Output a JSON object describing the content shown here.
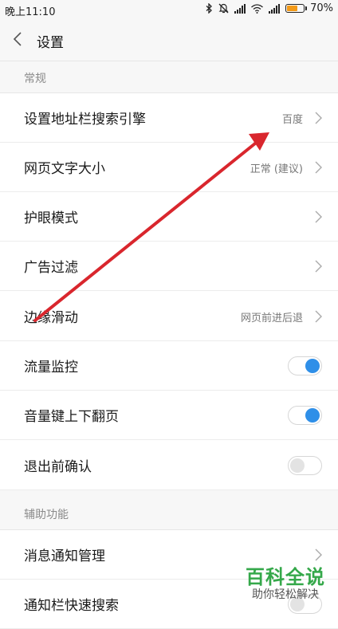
{
  "status_bar": {
    "time": "晚上11:10",
    "battery": "70%",
    "battery_level": 0.7
  },
  "header": {
    "title": "设置"
  },
  "sections": [
    {
      "title": "常规"
    },
    {
      "title": "辅助功能"
    }
  ],
  "rows": [
    {
      "label": "设置地址栏搜索引擎",
      "value": "百度",
      "control": "chevron"
    },
    {
      "label": "网页文字大小",
      "value": "正常 (建议)",
      "control": "chevron"
    },
    {
      "label": "护眼模式",
      "value": "",
      "control": "chevron"
    },
    {
      "label": "广告过滤",
      "value": "",
      "control": "chevron"
    },
    {
      "label": "边缘滑动",
      "value": "网页前进后退",
      "control": "chevron"
    },
    {
      "label": "流量监控",
      "control": "toggle",
      "checked": true
    },
    {
      "label": "音量键上下翻页",
      "control": "toggle",
      "checked": true
    },
    {
      "label": "退出前确认",
      "control": "toggle",
      "checked": false
    },
    {
      "label": "消息通知管理",
      "value": "",
      "control": "chevron"
    },
    {
      "label": "通知栏快速搜索",
      "control": "toggle",
      "checked": false
    }
  ],
  "watermark": {
    "title": "百科全说",
    "subtitle": "助你轻松解决"
  },
  "colors": {
    "accent": "#2f8fe8",
    "annotation_arrow": "#d9262d",
    "battery": "#f39a18",
    "watermark": "#35a84a"
  }
}
